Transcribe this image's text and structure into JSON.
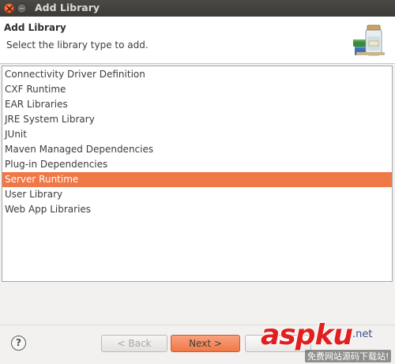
{
  "window": {
    "title": "Add Library"
  },
  "banner": {
    "title": "Add Library",
    "message": "Select the library type to add.",
    "icon": "library-jars-icon"
  },
  "library_types": {
    "items": [
      {
        "label": "Connectivity Driver Definition",
        "selected": false
      },
      {
        "label": "CXF Runtime",
        "selected": false
      },
      {
        "label": "EAR Libraries",
        "selected": false
      },
      {
        "label": "JRE System Library",
        "selected": false
      },
      {
        "label": "JUnit",
        "selected": false
      },
      {
        "label": "Maven Managed Dependencies",
        "selected": false
      },
      {
        "label": "Plug-in Dependencies",
        "selected": false
      },
      {
        "label": "Server Runtime",
        "selected": true
      },
      {
        "label": "User Library",
        "selected": false
      },
      {
        "label": "Web App Libraries",
        "selected": false
      }
    ]
  },
  "buttons": {
    "help_label": "?",
    "back_label": "< Back",
    "next_label": "Next >",
    "back_enabled": false
  },
  "watermark": {
    "main": "aspku",
    "suffix": ".net",
    "tagline": "免费网站源码下载站!"
  },
  "colors": {
    "selection": "#f07746",
    "titlebar": "#3c3b37",
    "close_button": "#e0541e"
  }
}
